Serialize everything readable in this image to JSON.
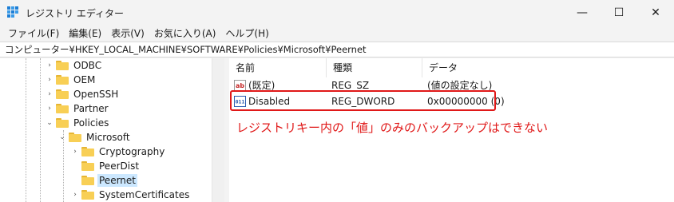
{
  "window": {
    "title": "レジストリ エディター",
    "minimize": "—",
    "maximize": "☐",
    "close": "✕"
  },
  "menu": [
    "ファイル(F)",
    "編集(E)",
    "表示(V)",
    "お気に入り(A)",
    "ヘルプ(H)"
  ],
  "address": "コンピューター¥HKEY_LOCAL_MACHINE¥SOFTWARE¥Policies¥Microsoft¥Peernet",
  "tree": [
    {
      "label": "ODBC",
      "expander": "›"
    },
    {
      "label": "OEM",
      "expander": "›"
    },
    {
      "label": "OpenSSH",
      "expander": "›"
    },
    {
      "label": "Partner",
      "expander": "›"
    },
    {
      "label": "Policies",
      "expander": "⌄"
    },
    {
      "label": "Microsoft",
      "expander": "⌄"
    },
    {
      "label": "Cryptography",
      "expander": "›"
    },
    {
      "label": "PeerDist",
      "expander": ""
    },
    {
      "label": "Peernet",
      "expander": "",
      "selected": true
    },
    {
      "label": "SystemCertificates",
      "expander": "›"
    }
  ],
  "columns": {
    "name": "名前",
    "type": "種類",
    "data": "データ"
  },
  "values": [
    {
      "icon": "string-value-icon",
      "icon_text": "ab",
      "name": "(既定)",
      "type": "REG_SZ",
      "data": "(値の設定なし)"
    },
    {
      "icon": "binary-value-icon",
      "icon_text": "011",
      "name": "Disabled",
      "type": "REG_DWORD",
      "data": "0x00000000 (0)"
    }
  ],
  "annotation": "レジストリキー内の「値」のみのバックアップはできない",
  "colors": {
    "accent_red": "#e01818",
    "selection": "#cce8ff",
    "folder": "#f8cf55"
  }
}
